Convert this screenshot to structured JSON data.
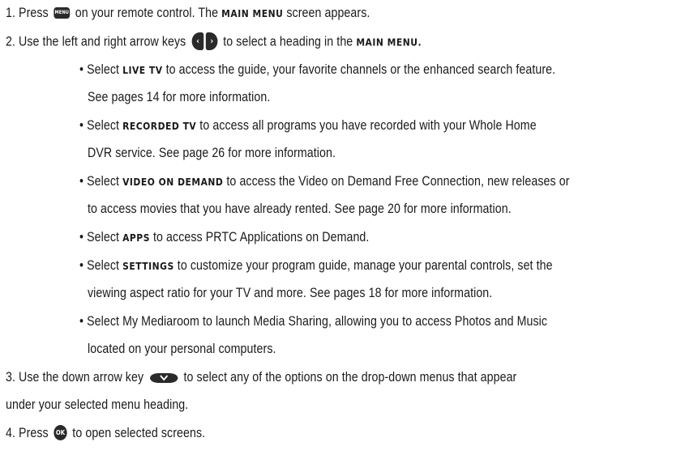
{
  "icons": {
    "menu_label": "MENU",
    "ok_label": "OK",
    "left_arrow": "‹",
    "right_arrow": "›"
  },
  "step1": {
    "prefix": "1. Press",
    "mid": "on your remote control. The",
    "keyword": "MAIN MENU",
    "suffix": "screen appears."
  },
  "step2": {
    "prefix": "2. Use the left and right arrow keys",
    "mid": "to select a heading in the",
    "keyword": "MAIN MENU."
  },
  "bullets": [
    {
      "pre": "• Select",
      "keyword": "LIVE TV",
      "line1": "to access the guide, your favorite channels or the enhanced search feature.",
      "line2": "See pages 14 for more information."
    },
    {
      "pre": "• Select",
      "keyword": "RECORDED TV",
      "line1": "to access all programs you have recorded with your Whole Home",
      "line2": "DVR service. See page 26 for more information."
    },
    {
      "pre": "• Select",
      "keyword": "VIDEO ON DEMAND",
      "line1": "to access the Video on Demand Free Connection, new releases or",
      "line2": "to access movies that you have already rented. See page 20 for more information."
    },
    {
      "pre": "• Select",
      "keyword": "APPS",
      "line1": "to access PRTC Applications on Demand.",
      "line2": ""
    },
    {
      "pre": "• Select",
      "keyword": "SETTINGS",
      "line1": "to customize your program guide, manage your parental controls, set the",
      "line2": "viewing aspect ratio for your TV and more. See pages 18 for more information."
    },
    {
      "pre": "• Select My Mediaroom to launch Media Sharing, allowing you to access Photos and Music",
      "keyword": "",
      "line1": "",
      "line2": "located on your personal computers."
    }
  ],
  "step3": {
    "prefix": "3. Use the down arrow key",
    "line1": "to select any of the options on the drop-down menus that appear",
    "line2": "under your selected menu heading."
  },
  "step4": {
    "prefix": "4. Press",
    "suffix": "to open selected screens."
  }
}
